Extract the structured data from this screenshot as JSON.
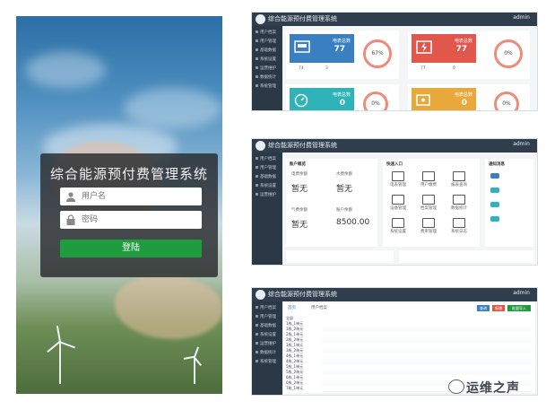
{
  "login": {
    "title": "综合能源预付费管理系统",
    "username_placeholder": "用户名",
    "password_placeholder": "密码",
    "login_button": "登陆"
  },
  "admin": {
    "app_title": "综合能源预付费管理系统",
    "user_label": "admin",
    "sidebar_items": [
      "用户档案",
      "用户管理",
      "基础数据",
      "系统设置",
      "运营维护",
      "数据统计",
      "系统管理"
    ]
  },
  "dashboard1": {
    "tiles": [
      {
        "label": "电表总数",
        "value": "77",
        "color": "#3a7fc1"
      },
      {
        "label": "电表总数",
        "value": "77",
        "color": "#e2574c"
      },
      {
        "label": "电表总数",
        "value": "0",
        "color": "#2fb3b8"
      },
      {
        "label": "电表总数",
        "value": "0",
        "color": "#e8a93a"
      }
    ],
    "rings": [
      "67%",
      "0%",
      "0%",
      "0%"
    ],
    "stats": [
      "74",
      "3",
      "77",
      "0"
    ]
  },
  "dashboard2": {
    "balance_title": "账户概览",
    "quick_title": "快速入口",
    "notice_title": "通知消息",
    "balances": [
      {
        "label": "电费余额",
        "value": "暂无"
      },
      {
        "label": "水费余额",
        "value": "暂无"
      },
      {
        "label": "气费余额",
        "value": "暂无"
      },
      {
        "label": "账户余额",
        "value": "8500.00"
      }
    ],
    "quick_items": [
      "电表管理",
      "用户缴费",
      "报表查询",
      "设备管理",
      "档案管理",
      "数据统计",
      "系统设置",
      "费率管理",
      "系统日志"
    ]
  },
  "table_view": {
    "tabs": [
      "首页",
      "用户档案"
    ],
    "toolbar_buttons": [
      "查询",
      "新增",
      "批量导入"
    ],
    "tree_items": [
      "全部",
      "1栋_1单元",
      "1栋_2单元",
      "2栋_1单元",
      "2栋_2单元",
      "3栋_1单元",
      "3栋_2单元",
      "4栋_1单元",
      "4栋_2单元",
      "5栋_1单元",
      "5栋_2单元",
      "6栋_1单元",
      "6栋_2单元",
      "7栋_1单元"
    ],
    "rows": 13
  },
  "watermark": {
    "text": "运维之声"
  }
}
